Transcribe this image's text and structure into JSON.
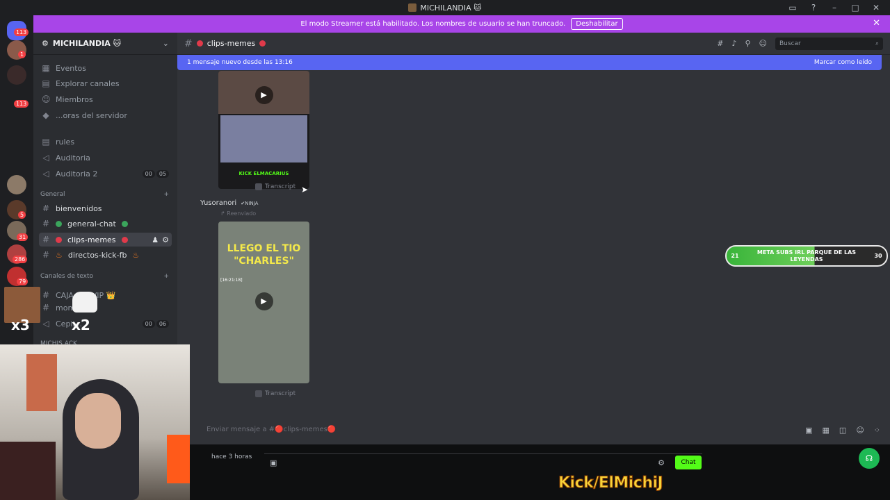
{
  "window": {
    "title": "MICHILANDIA 🐱"
  },
  "streamer_banner": {
    "text": "El modo Streamer está habilitado. Los nombres de usuario se han truncado.",
    "button": "Deshabilitar"
  },
  "server": {
    "name": "MICHILANDIA 🐱",
    "badges": [
      "113",
      "1",
      "113",
      "5",
      "31",
      "286",
      "79"
    ]
  },
  "sidebar": {
    "top_items": [
      "Eventos",
      "Explorar canales",
      "Miembros",
      "...oras del servidor"
    ],
    "misc_items": [
      "rules",
      "Auditoria",
      "Auditoria 2"
    ],
    "auditoria2_pills": [
      "00",
      "05"
    ],
    "category_general": "General",
    "general_channels": [
      "bienvenidos",
      "general-chat",
      "clips-memes",
      "directos-kick-fb"
    ],
    "category_text": "Canales de texto",
    "vip_channel": "CAJA D... VIP 👑",
    "other_channels": [
      "mom...",
      "Cepil..."
    ],
    "cepil_pills": [
      "00",
      "06"
    ],
    "category_bottom": "MICHIS ACK"
  },
  "channel_header": {
    "name": "clips-memes",
    "search_placeholder": "Buscar"
  },
  "new_messages_bar": {
    "text": "1 mensaje nuevo desde las 13:16",
    "mark_read": "Marcar como leído"
  },
  "messages": {
    "transcript_label": "Transcript",
    "video1_caption": "KICK ELMACARIUS",
    "username": "Yusoranori",
    "user_tag": "✔NINJA",
    "forwarded": "Reenviado",
    "video2_caption": "LLEGO EL TIO \"CHARLES\"",
    "video2_time": "[16:21:18]"
  },
  "composer": {
    "placeholder": "Enviar mensaje a #🔴clips-memes🔴"
  },
  "goal_overlay": {
    "left": "21",
    "text": "META SUBS IRL PARQUE DE LAS LEYENDAS",
    "right": "30",
    "progress": 0.55
  },
  "overlays": {
    "multiplier_a": "x3",
    "multiplier_b": "x2",
    "time_ago": "hace 3 horas",
    "chat_button": "Chat",
    "brand": "Kick/ElMichiJ"
  },
  "colors": {
    "blurple": "#5865f2",
    "streamer_purple": "#a845e8",
    "kick_green": "#53fc18"
  }
}
